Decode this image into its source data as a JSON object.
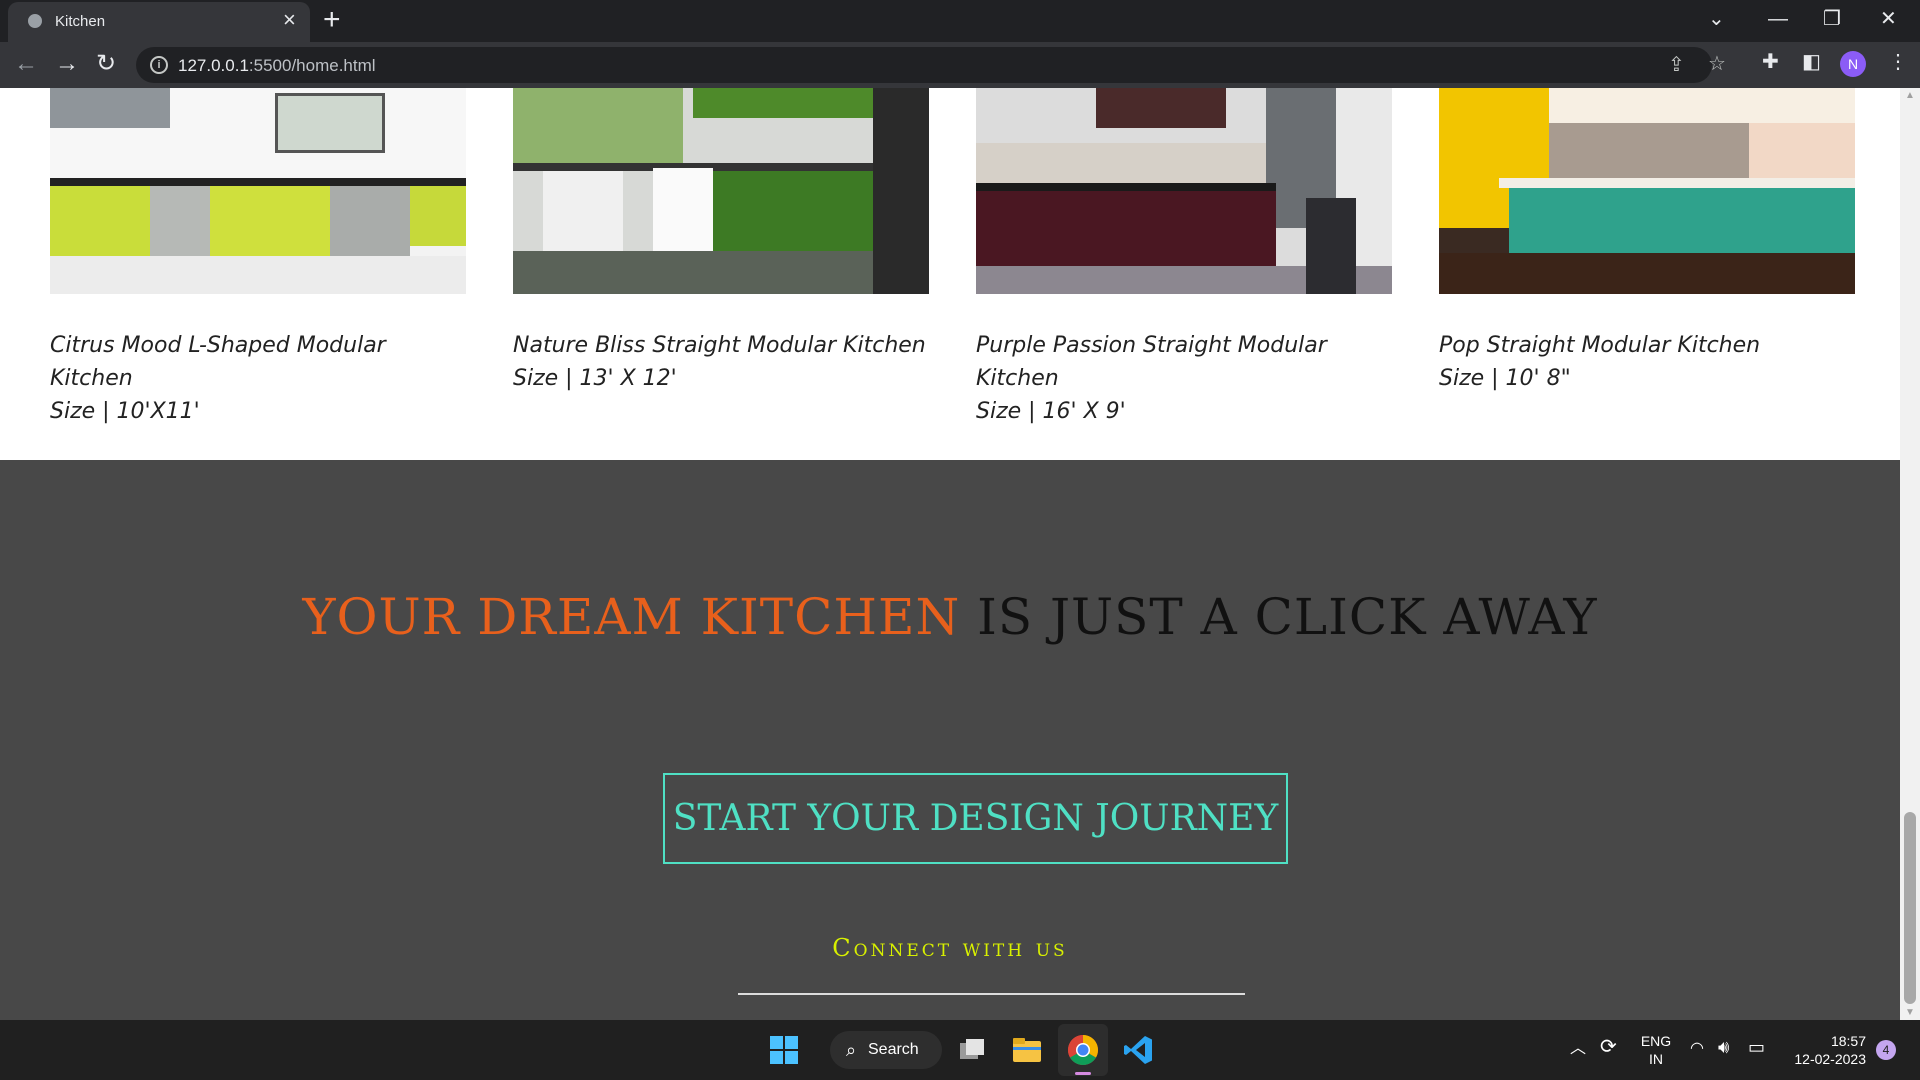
{
  "browser": {
    "tab_title": "Kitchen",
    "url_host": "127.0.0.1",
    "url_rest": ":5500/home.html",
    "profile_initial": "N"
  },
  "products": [
    {
      "name": "Citrus Mood L-Shaped Modular Kitchen",
      "size": "Size | 10'X11'"
    },
    {
      "name": "Nature Bliss Straight Modular Kitchen",
      "size": "Size | 13' X 12'"
    },
    {
      "name": "Purple Passion Straight Modular Kitchen",
      "size": "Size | 16' X 9'"
    },
    {
      "name": "Pop Straight Modular Kitchen",
      "size": "Size | 10' 8\""
    }
  ],
  "footer": {
    "headline_highlight": "YOUR DREAM KITCHEN",
    "headline_rest": " IS JUST A CLICK AWAY",
    "cta_label": "START YOUR DESIGN JOURNEY",
    "connect_title": "Connect with us",
    "social": [
      "facebook-icon",
      "instagram-icon",
      "twitter-icon"
    ]
  },
  "taskbar": {
    "search_label": "Search",
    "lang_top": "ENG",
    "lang_bottom": "IN",
    "time": "18:57",
    "date": "12-02-2023",
    "notification_count": "4"
  },
  "colors": {
    "accent_orange": "#e8601c",
    "accent_teal": "#4fe0c4",
    "accent_lime": "#d8f000",
    "footer_bg": "#484848"
  }
}
